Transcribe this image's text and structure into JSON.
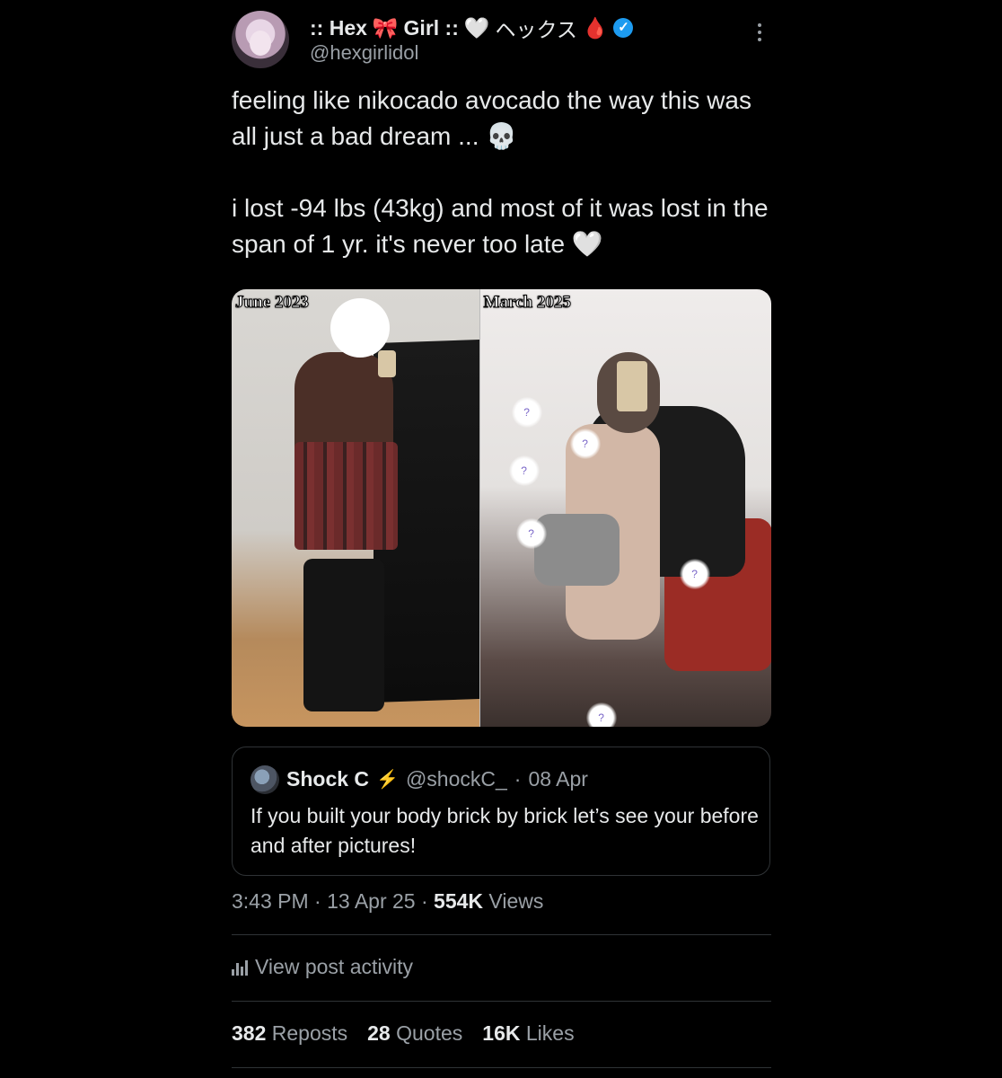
{
  "author": {
    "display_name_prefix": ":: Hex",
    "display_name_bow": "🎀",
    "display_name_suffix": "Girl ::",
    "display_name_heart": "🤍",
    "display_name_jp": "ヘックス",
    "display_name_drop": "🩸",
    "verified_mark": "✓",
    "handle": "@hexgirlidol"
  },
  "tweet": {
    "paragraph1": "feeling like nikocado avocado the way this was all just a bad dream ... 💀",
    "paragraph2": "i lost -94 lbs (43kg) and most of it was lost in the span of 1 yr. it's never too late 🤍"
  },
  "photo": {
    "left_label": "June 2023",
    "right_label": "March 2025",
    "bubble_mark": "?"
  },
  "quote": {
    "name": "Shock C",
    "bolt": "⚡",
    "handle": "@shockC_",
    "separator": "·",
    "date": "08 Apr",
    "text": "If you built your body brick by brick let’s see your before and after pictures!"
  },
  "meta": {
    "time": "3:43 PM",
    "sep1": "·",
    "date": "13 Apr 25",
    "sep2": "·",
    "views_count": "554K",
    "views_label": "Views"
  },
  "activity": {
    "label": "View post activity"
  },
  "stats": {
    "reposts_count": "382",
    "reposts_label": "Reposts",
    "quotes_count": "28",
    "quotes_label": "Quotes",
    "likes_count": "16K",
    "likes_label": "Likes"
  },
  "colors": {
    "background": "#000000",
    "text_primary": "#e7e9ea",
    "text_secondary": "#9aa0a6",
    "verified_blue": "#1d9bf0",
    "divider": "#2f3336"
  }
}
